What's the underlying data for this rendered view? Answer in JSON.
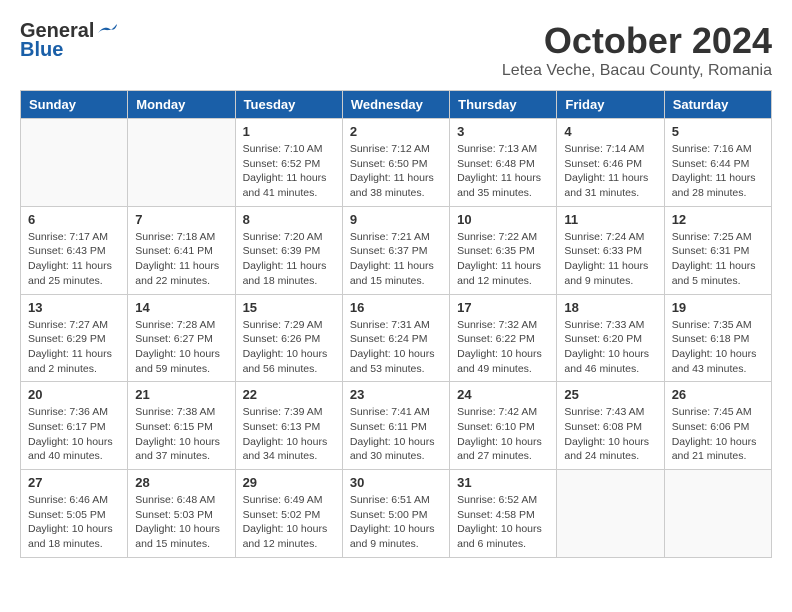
{
  "header": {
    "logo_general": "General",
    "logo_blue": "Blue",
    "month_title": "October 2024",
    "subtitle": "Letea Veche, Bacau County, Romania"
  },
  "days_of_week": [
    "Sunday",
    "Monday",
    "Tuesday",
    "Wednesday",
    "Thursday",
    "Friday",
    "Saturday"
  ],
  "weeks": [
    [
      {
        "day": "",
        "content": ""
      },
      {
        "day": "",
        "content": ""
      },
      {
        "day": "1",
        "content": "Sunrise: 7:10 AM\nSunset: 6:52 PM\nDaylight: 11 hours and 41 minutes."
      },
      {
        "day": "2",
        "content": "Sunrise: 7:12 AM\nSunset: 6:50 PM\nDaylight: 11 hours and 38 minutes."
      },
      {
        "day": "3",
        "content": "Sunrise: 7:13 AM\nSunset: 6:48 PM\nDaylight: 11 hours and 35 minutes."
      },
      {
        "day": "4",
        "content": "Sunrise: 7:14 AM\nSunset: 6:46 PM\nDaylight: 11 hours and 31 minutes."
      },
      {
        "day": "5",
        "content": "Sunrise: 7:16 AM\nSunset: 6:44 PM\nDaylight: 11 hours and 28 minutes."
      }
    ],
    [
      {
        "day": "6",
        "content": "Sunrise: 7:17 AM\nSunset: 6:43 PM\nDaylight: 11 hours and 25 minutes."
      },
      {
        "day": "7",
        "content": "Sunrise: 7:18 AM\nSunset: 6:41 PM\nDaylight: 11 hours and 22 minutes."
      },
      {
        "day": "8",
        "content": "Sunrise: 7:20 AM\nSunset: 6:39 PM\nDaylight: 11 hours and 18 minutes."
      },
      {
        "day": "9",
        "content": "Sunrise: 7:21 AM\nSunset: 6:37 PM\nDaylight: 11 hours and 15 minutes."
      },
      {
        "day": "10",
        "content": "Sunrise: 7:22 AM\nSunset: 6:35 PM\nDaylight: 11 hours and 12 minutes."
      },
      {
        "day": "11",
        "content": "Sunrise: 7:24 AM\nSunset: 6:33 PM\nDaylight: 11 hours and 9 minutes."
      },
      {
        "day": "12",
        "content": "Sunrise: 7:25 AM\nSunset: 6:31 PM\nDaylight: 11 hours and 5 minutes."
      }
    ],
    [
      {
        "day": "13",
        "content": "Sunrise: 7:27 AM\nSunset: 6:29 PM\nDaylight: 11 hours and 2 minutes."
      },
      {
        "day": "14",
        "content": "Sunrise: 7:28 AM\nSunset: 6:27 PM\nDaylight: 10 hours and 59 minutes."
      },
      {
        "day": "15",
        "content": "Sunrise: 7:29 AM\nSunset: 6:26 PM\nDaylight: 10 hours and 56 minutes."
      },
      {
        "day": "16",
        "content": "Sunrise: 7:31 AM\nSunset: 6:24 PM\nDaylight: 10 hours and 53 minutes."
      },
      {
        "day": "17",
        "content": "Sunrise: 7:32 AM\nSunset: 6:22 PM\nDaylight: 10 hours and 49 minutes."
      },
      {
        "day": "18",
        "content": "Sunrise: 7:33 AM\nSunset: 6:20 PM\nDaylight: 10 hours and 46 minutes."
      },
      {
        "day": "19",
        "content": "Sunrise: 7:35 AM\nSunset: 6:18 PM\nDaylight: 10 hours and 43 minutes."
      }
    ],
    [
      {
        "day": "20",
        "content": "Sunrise: 7:36 AM\nSunset: 6:17 PM\nDaylight: 10 hours and 40 minutes."
      },
      {
        "day": "21",
        "content": "Sunrise: 7:38 AM\nSunset: 6:15 PM\nDaylight: 10 hours and 37 minutes."
      },
      {
        "day": "22",
        "content": "Sunrise: 7:39 AM\nSunset: 6:13 PM\nDaylight: 10 hours and 34 minutes."
      },
      {
        "day": "23",
        "content": "Sunrise: 7:41 AM\nSunset: 6:11 PM\nDaylight: 10 hours and 30 minutes."
      },
      {
        "day": "24",
        "content": "Sunrise: 7:42 AM\nSunset: 6:10 PM\nDaylight: 10 hours and 27 minutes."
      },
      {
        "day": "25",
        "content": "Sunrise: 7:43 AM\nSunset: 6:08 PM\nDaylight: 10 hours and 24 minutes."
      },
      {
        "day": "26",
        "content": "Sunrise: 7:45 AM\nSunset: 6:06 PM\nDaylight: 10 hours and 21 minutes."
      }
    ],
    [
      {
        "day": "27",
        "content": "Sunrise: 6:46 AM\nSunset: 5:05 PM\nDaylight: 10 hours and 18 minutes."
      },
      {
        "day": "28",
        "content": "Sunrise: 6:48 AM\nSunset: 5:03 PM\nDaylight: 10 hours and 15 minutes."
      },
      {
        "day": "29",
        "content": "Sunrise: 6:49 AM\nSunset: 5:02 PM\nDaylight: 10 hours and 12 minutes."
      },
      {
        "day": "30",
        "content": "Sunrise: 6:51 AM\nSunset: 5:00 PM\nDaylight: 10 hours and 9 minutes."
      },
      {
        "day": "31",
        "content": "Sunrise: 6:52 AM\nSunset: 4:58 PM\nDaylight: 10 hours and 6 minutes."
      },
      {
        "day": "",
        "content": ""
      },
      {
        "day": "",
        "content": ""
      }
    ]
  ]
}
